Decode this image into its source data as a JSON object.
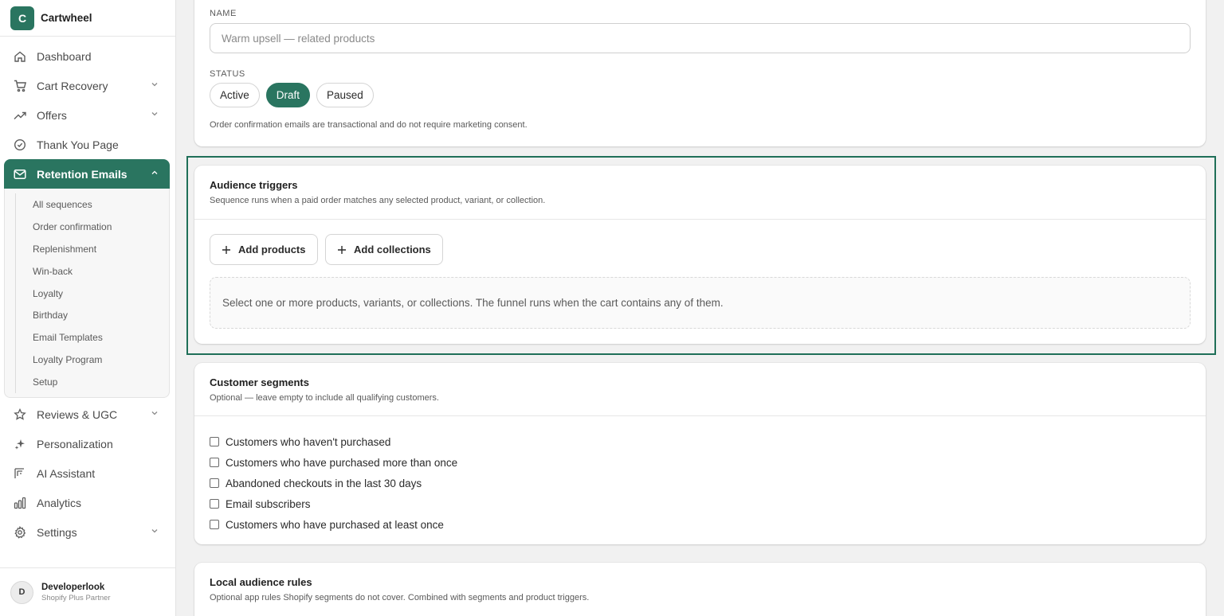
{
  "brand": {
    "logo_letter": "C",
    "name": "Cartwheel",
    "accent": "#2a7560"
  },
  "nav": {
    "items_top": [
      {
        "label": "Dashboard",
        "icon": "home-icon"
      },
      {
        "label": "Cart Recovery",
        "icon": "cart-icon"
      },
      {
        "label": "Offers",
        "icon": "trending-icon"
      },
      {
        "label": "Thank You Page",
        "icon": "check-circle-icon"
      }
    ],
    "active": {
      "label": "Retention Emails",
      "icon": "mail-icon"
    },
    "sub_items": [
      "All sequences",
      "Order confirmation",
      "Replenishment",
      "Win-back",
      "Loyalty",
      "Birthday",
      "Email Templates",
      "Loyalty Program",
      "Setup"
    ],
    "items_bottom": [
      {
        "label": "Reviews & UGC",
        "icon": "star-icon"
      },
      {
        "label": "Personalization",
        "icon": "sparkle-icon"
      },
      {
        "label": "AI Assistant",
        "icon": "ai-icon"
      },
      {
        "label": "Analytics",
        "icon": "chart-icon"
      },
      {
        "label": "Settings",
        "icon": "gear-icon"
      }
    ]
  },
  "user": {
    "initial": "D",
    "name": "Developerlook",
    "role": "Shopify Plus Partner"
  },
  "form": {
    "name_label": "NAME",
    "name_placeholder": "Warm upsell — related products",
    "status_label": "STATUS",
    "status_options": [
      "Active",
      "Draft",
      "Paused"
    ],
    "status_selected": "Draft",
    "status_note": "Order confirmation emails are transactional and do not require marketing consent."
  },
  "audience": {
    "title": "Audience triggers",
    "subtitle": "Sequence runs when a paid order matches any selected product, variant, or collection.",
    "add_products": "Add products",
    "add_collections": "Add collections",
    "empty_text": "Select one or more products, variants, or collections. The funnel runs when the cart contains any of them."
  },
  "segments": {
    "title": "Customer segments",
    "subtitle": "Optional — leave empty to include all qualifying customers.",
    "options": [
      "Customers who haven't purchased",
      "Customers who have purchased more than once",
      "Abandoned checkouts in the last 30 days",
      "Email subscribers",
      "Customers who have purchased at least once"
    ]
  },
  "local_rules": {
    "title": "Local audience rules",
    "subtitle": "Optional app rules Shopify segments do not cover. Combined with segments and product triggers."
  }
}
